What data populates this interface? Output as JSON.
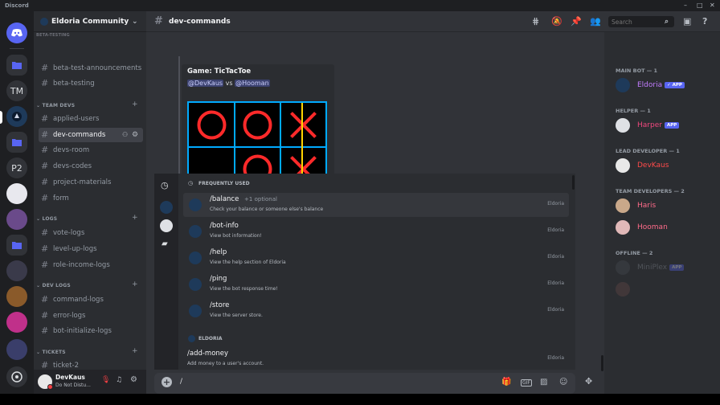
{
  "app": {
    "title": "Discord"
  },
  "server": {
    "name": "Eldoria Community"
  },
  "guilds": [
    {
      "label": ""
    },
    {
      "label": ""
    },
    {
      "label": "TM"
    },
    {
      "label": ""
    },
    {
      "label": ""
    },
    {
      "label": "P2"
    },
    {
      "label": ""
    },
    {
      "label": ""
    },
    {
      "label": ""
    },
    {
      "label": ""
    },
    {
      "label": ""
    },
    {
      "label": ""
    },
    {
      "label": ""
    }
  ],
  "sidebar": {
    "partial_category": "BETA-TESTING",
    "channels_beta": [
      "beta-test-announcements",
      "beta-testing"
    ],
    "cat_team": "TEAM DEVS",
    "channels_team": [
      "applied-users",
      "dev-commands",
      "devs-room",
      "devs-codes",
      "project-materials",
      "form"
    ],
    "cat_logs": "LOGS",
    "channels_logs": [
      "vote-logs",
      "level-up-logs",
      "role-income-logs"
    ],
    "cat_devlogs": "DEV LOGS",
    "channels_devlogs": [
      "command-logs",
      "error-logs",
      "bot-initialize-logs"
    ],
    "cat_tickets": "TICKETS",
    "channels_tickets": [
      "ticket-2"
    ]
  },
  "user": {
    "name": "DevKaus",
    "status": "Do Not Distu..."
  },
  "channel": {
    "name": "dev-commands"
  },
  "search": {
    "placeholder": "Search"
  },
  "message": {
    "game_title": "Game: TicTacToe",
    "mention1": "@DevKaus",
    "vs": "vs",
    "mention2": "@Hooman"
  },
  "board": {
    "cells": [
      "O",
      "O",
      "X",
      "",
      "O",
      "X"
    ]
  },
  "popup": {
    "section_frequent": "FREQUENTLY USED",
    "commands": [
      {
        "name": "/balance",
        "optional": "+1 optional",
        "desc": "Check your balance or someone else's balance",
        "source": "Eldoria"
      },
      {
        "name": "/bot-info",
        "optional": "",
        "desc": "View bot information!",
        "source": "Eldoria"
      },
      {
        "name": "/help",
        "optional": "",
        "desc": "View the help section of Eldoria",
        "source": "Eldoria"
      },
      {
        "name": "/ping",
        "optional": "",
        "desc": "View the bot response time!",
        "source": "Eldoria"
      },
      {
        "name": "/store",
        "optional": "",
        "desc": "View the server store.",
        "source": "Eldoria"
      }
    ],
    "section_eldoria": "ELDORIA",
    "eldoria_command": {
      "name": "/add-money",
      "desc": "Add money to a user's account.",
      "source": "Eldoria"
    }
  },
  "composer": {
    "value": "/"
  },
  "members": {
    "groups": [
      {
        "label": "MAIN BOT — 1",
        "members": [
          {
            "name": "Eldoria",
            "badge": "✓ APP",
            "color": "#c27cff"
          }
        ]
      },
      {
        "label": "HELPER — 1",
        "members": [
          {
            "name": "Harper",
            "badge": "APP",
            "color": "#f0487e"
          }
        ]
      },
      {
        "label": "LEAD DEVELOPER — 1",
        "members": [
          {
            "name": "DevKaus",
            "badge": "",
            "color": "#ff4a4a"
          }
        ]
      },
      {
        "label": "TEAM DEVELOPERS — 2",
        "members": [
          {
            "name": "Haris",
            "badge": "",
            "color": "#ff6b8a"
          },
          {
            "name": "Hooman",
            "badge": "",
            "color": "#ff6b8a"
          }
        ]
      },
      {
        "label": "OFFLINE — 2",
        "members": [
          {
            "name": "MiniPlex",
            "badge": "APP",
            "color": "#5d6068"
          },
          {
            "name": "",
            "badge": "",
            "color": "#5d6068"
          }
        ]
      }
    ]
  },
  "colors": {
    "accent": "#5865f2",
    "board_border": "#00aaff",
    "o_color": "#ff2a2a",
    "x_color": "#ff2a2a",
    "win_line": "#ffd400"
  }
}
